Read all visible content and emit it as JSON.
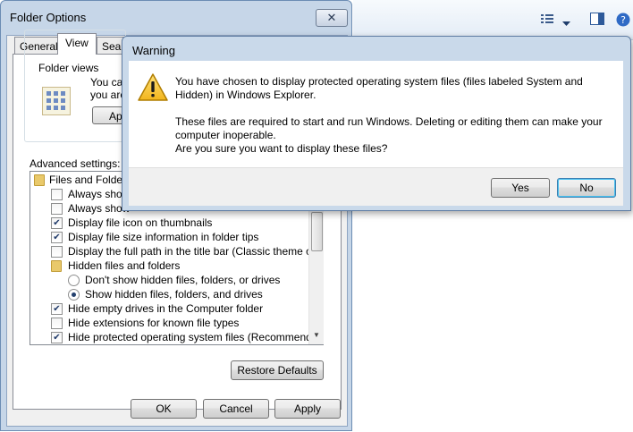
{
  "folder_options": {
    "title": "Folder Options",
    "close_glyph": "✕",
    "tabs": [
      "General",
      "View",
      "Search"
    ],
    "tab_visible_text": [
      "General",
      "View",
      "Searc"
    ],
    "folder_views": {
      "label": "Folder views",
      "text_lines": [
        "You ca",
        "you are"
      ],
      "apply_button_partial": "App"
    },
    "advanced_label": "Advanced settings:",
    "tree": [
      {
        "kind": "folder",
        "label": "Files and Folders"
      },
      {
        "kind": "checkbox",
        "checked": false,
        "label": "Always show"
      },
      {
        "kind": "checkbox",
        "checked": false,
        "label": "Always show"
      },
      {
        "kind": "checkbox",
        "checked": true,
        "label": "Display file icon on thumbnails"
      },
      {
        "kind": "checkbox",
        "checked": true,
        "label": "Display file size information in folder tips"
      },
      {
        "kind": "checkbox",
        "checked": false,
        "label": "Display the full path in the title bar (Classic theme only)"
      },
      {
        "kind": "folder",
        "label": "Hidden files and folders"
      },
      {
        "kind": "radio",
        "checked": false,
        "label": "Don't show hidden files, folders, or drives"
      },
      {
        "kind": "radio",
        "checked": true,
        "label": "Show hidden files, folders, and drives"
      },
      {
        "kind": "checkbox",
        "checked": true,
        "label": "Hide empty drives in the Computer folder"
      },
      {
        "kind": "checkbox",
        "checked": false,
        "label": "Hide extensions for known file types"
      },
      {
        "kind": "checkbox",
        "checked": true,
        "label": "Hide protected operating system files (Recommended)"
      }
    ],
    "restore_defaults": "Restore Defaults",
    "ok": "OK",
    "cancel": "Cancel",
    "apply": "Apply"
  },
  "warning": {
    "title": "Warning",
    "icon": "warning-triangle-icon",
    "line1": "You have chosen to display protected operating system files (files labeled System and Hidden) in Windows Explorer.",
    "line2": "These files are required to start and run Windows. Deleting or editing them can make your computer inoperable.",
    "line3": "Are you sure you want to display these files?",
    "yes": "Yes",
    "no": "No"
  },
  "explorer_toolbar": {
    "icons": [
      "view-options-icon",
      "dropdown-arrow-icon",
      "preview-pane-icon",
      "help-icon"
    ],
    "help_glyph": "?"
  }
}
